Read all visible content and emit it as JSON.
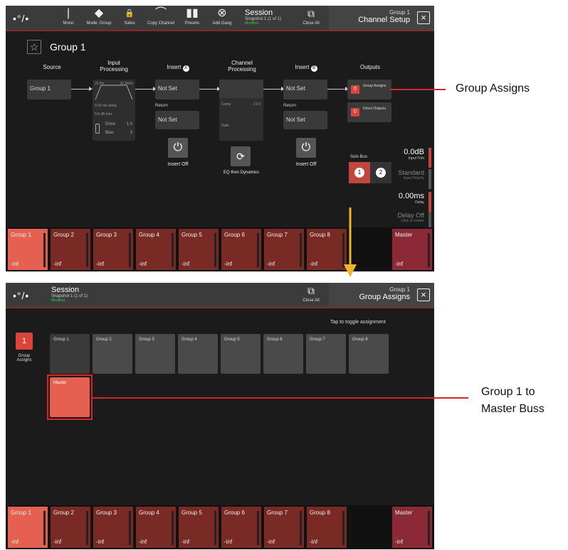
{
  "panel1": {
    "toolbar": {
      "logo": "•°/•",
      "buttons": [
        {
          "label": "Mono",
          "icon": "|"
        },
        {
          "label": "Mode: Group",
          "icon": "◆"
        },
        {
          "label": "Safes",
          "icon": "🔒"
        },
        {
          "label": "Copy Channel",
          "icon": "⌒"
        },
        {
          "label": "Presets",
          "icon": "▮▮"
        },
        {
          "label": "Add Gang",
          "icon": "⊗"
        }
      ],
      "session_title": "Session",
      "session_sub": "Snapshot 1 (1 of 1)",
      "session_status": "Modified",
      "close_all_label": "Close All",
      "header_line1": "Group 1",
      "header_line2": "Channel Setup",
      "close_icon": "×"
    },
    "channel_name": "Group 1",
    "star_icon": "☆",
    "sections": {
      "source": "Source",
      "input_processing": "Input\nProcessing",
      "insert_a": "Insert",
      "insert_a_badge": "A",
      "channel_processing": "Channel\nProcessing",
      "insert_b": "Insert",
      "insert_b_badge": "B",
      "outputs": "Outputs"
    },
    "source_value": "Group 1",
    "input_proc": {
      "hp": "20 Hz",
      "lp": "20.0kHz",
      "delay": "0.00 ms delay",
      "trim": "0.0 dB trim",
      "drive_label": "Drive",
      "drive_value": "1.0",
      "bias_label": "Bias",
      "bias_value": "3"
    },
    "insert_a_value": "Not Set",
    "return_label_a": "Return",
    "return_a_value": "Not Set",
    "insert_off_a": "Insert Off",
    "channel_proc": {
      "comp_label": "Comp",
      "comp_value": "2.0:1",
      "gate_label": "Gate",
      "order": "EQ then Dynamics"
    },
    "insert_b_value": "Not Set",
    "return_label_b": "Return",
    "return_b_value": "Not Set",
    "insert_off_b": "Insert Off",
    "outputs": {
      "group_assigns_count": "0",
      "group_assigns_label": "Group Assigns",
      "direct_count": "0",
      "direct_label": "Direct Outputs"
    },
    "solo_bus": {
      "label": "Solo Bus",
      "btn1": "1",
      "btn2": "2"
    },
    "input_trim": {
      "value": "0.0dB",
      "label": "Input Trim"
    },
    "polarity": {
      "value": "Standard",
      "label": "Input Polarity"
    },
    "delay": {
      "value": "0.00ms",
      "label": "Delay"
    },
    "delay_off": {
      "value": "Delay Off",
      "label": "Click to enable"
    },
    "strip": [
      {
        "name": "Group 1",
        "value": "-inf"
      },
      {
        "name": "Group 2",
        "value": "-inf"
      },
      {
        "name": "Group 3",
        "value": "-inf"
      },
      {
        "name": "Group 4",
        "value": "-inf"
      },
      {
        "name": "Group 5",
        "value": "-inf"
      },
      {
        "name": "Group 6",
        "value": "-inf"
      },
      {
        "name": "Group 7",
        "value": "-inf"
      },
      {
        "name": "Group 8",
        "value": "-inf"
      },
      {
        "name": "Master",
        "value": "-inf"
      }
    ]
  },
  "panel2": {
    "toolbar": {
      "logo": "•°/•",
      "session_title": "Session",
      "session_sub": "Snapshot 1 (1 of 1)",
      "session_status": "Modified",
      "close_all_label": "Close All",
      "header_line1": "Group 1",
      "header_line2": "Group Assigns",
      "close_icon": "×"
    },
    "tap_hint": "Tap to toggle assignment",
    "side_count": "1",
    "side_label": "Group\nAssigns",
    "groups": [
      "Group 1",
      "Group 2",
      "Group 3",
      "Group 4",
      "Group 5",
      "Group 6",
      "Group 7",
      "Group 8"
    ],
    "master": "Master",
    "strip": [
      {
        "name": "Group 1",
        "value": "-inf"
      },
      {
        "name": "Group 2",
        "value": "-inf"
      },
      {
        "name": "Group 3",
        "value": "-inf"
      },
      {
        "name": "Group 4",
        "value": "-inf"
      },
      {
        "name": "Group 5",
        "value": "-inf"
      },
      {
        "name": "Group 6",
        "value": "-inf"
      },
      {
        "name": "Group 7",
        "value": "-inf"
      },
      {
        "name": "Group 8",
        "value": "-inf"
      },
      {
        "name": "Master",
        "value": "-inf"
      }
    ]
  },
  "callouts": {
    "group_assigns": "Group Assigns",
    "master_line1": "Group 1 to",
    "master_line2": "Master Buss"
  },
  "colors": {
    "accent_red": "#d9453a",
    "callout_red": "#d42828",
    "arrow_yellow": "#f0b429",
    "selected_group": "#e56050",
    "group_strip": "#7a2a24",
    "master_strip": "#8b2a36"
  }
}
